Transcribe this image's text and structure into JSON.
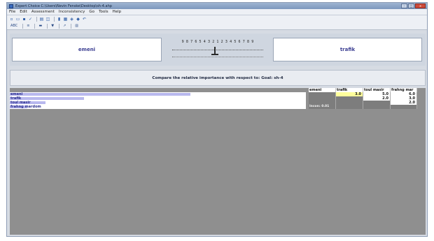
{
  "window": {
    "title": "Expert Choice  C:\\Users\\Nevin Fenske\\Desktop\\sh-4.ahp",
    "controls": [
      "–",
      "□",
      "✕"
    ]
  },
  "menu": [
    "File",
    "Edit",
    "Assessment",
    "Inconsistency",
    "Go",
    "Tools",
    "Help"
  ],
  "toolbar_icons": [
    "new-file-icon",
    "open-folder-icon",
    "save-icon",
    "check-icon",
    "print-icon",
    "preview-icon",
    "model-icon",
    "data-grid-icon",
    "formula-icon",
    "sensitivity-icon",
    "undo-icon"
  ],
  "comparison": {
    "left_item": "emeni",
    "right_item": "trafik",
    "scale_numbers": "9 8 7 6 5 4 3 2 1 2 3 4 5 6 7 8 9",
    "prompt": "Compare the relative importance with respect to: Goal: sh-4"
  },
  "matrix": {
    "columns": [
      "emeni",
      "trafik",
      "toul masir",
      "frahng mar"
    ],
    "rows": [
      {
        "name": "emeni",
        "bar": 0.61,
        "cells": [
          "",
          "3.0",
          "5.0",
          "6.0"
        ]
      },
      {
        "name": "trafik",
        "bar": 0.25,
        "cells": [
          "",
          "",
          "2.0",
          "3.0"
        ]
      },
      {
        "name": "toul masir",
        "bar": 0.12,
        "cells": [
          "",
          "",
          "",
          "2.0"
        ]
      },
      {
        "name": "frahng mardom",
        "bar": 0.06,
        "cells": [
          "Incon: 0.01",
          "",
          "",
          ""
        ]
      }
    ]
  },
  "colors": {
    "bar": "#b8b8ee",
    "selected_cell": "#ffff9c",
    "matrix_background": "#8f8f8f",
    "item_text": "#3c3f92"
  }
}
